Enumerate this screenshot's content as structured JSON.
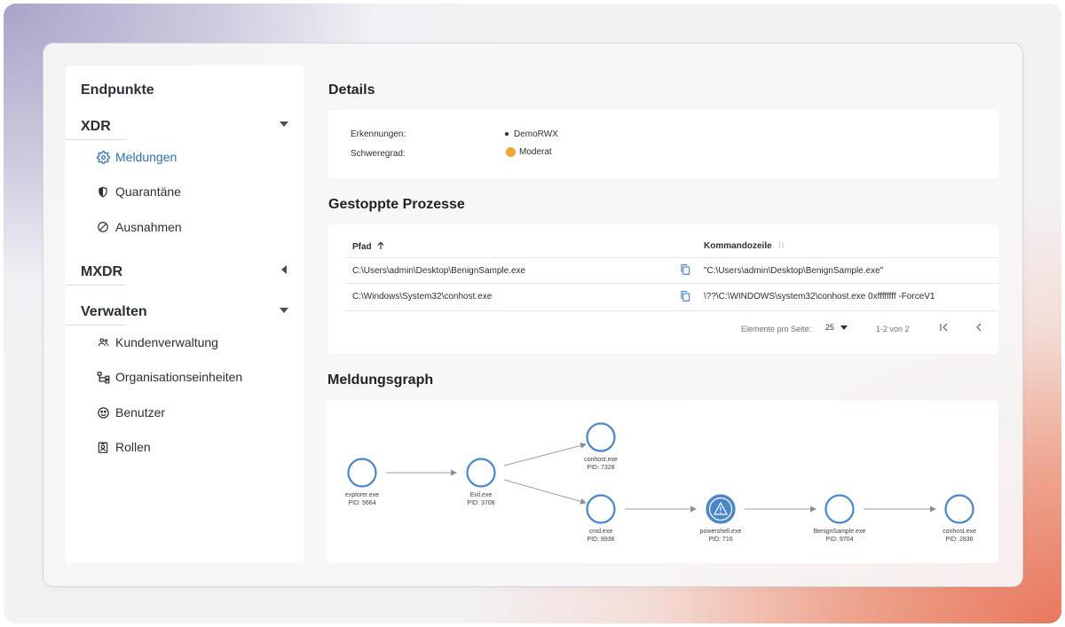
{
  "sidebar": {
    "title": "Endpunkte",
    "sections": [
      {
        "label": "XDR",
        "items": [
          {
            "label": "Meldungen",
            "icon": "gear-icon",
            "active": true
          },
          {
            "label": "Quarantäne",
            "icon": "shield-icon"
          },
          {
            "label": "Ausnahmen",
            "icon": "block-icon"
          }
        ]
      },
      {
        "label": "MXDR",
        "items": []
      },
      {
        "label": "Verwalten",
        "items": [
          {
            "label": "Kundenverwaltung",
            "icon": "users-icon"
          },
          {
            "label": "Organisationseinheiten",
            "icon": "org-units-icon"
          },
          {
            "label": "Benutzer",
            "icon": "user-circle-icon"
          },
          {
            "label": "Rollen",
            "icon": "id-badge-icon"
          }
        ]
      }
    ]
  },
  "details": {
    "heading": "Details",
    "detections_label": "Erkennungen:",
    "detections_value": "DemoRWX",
    "severity_label": "Schweregrad:",
    "severity_value": "Moderat",
    "severity_color": "#f2a636"
  },
  "processes": {
    "heading": "Gestoppte Prozesse",
    "col_path": "Pfad",
    "col_cmd": "Kommandozeile",
    "rows": [
      {
        "path": "C:\\Users\\admin\\Desktop\\BenignSample.exe",
        "cmd": "\"C:\\Users\\admin\\Desktop\\BenignSample.exe\""
      },
      {
        "path": "C:\\Windows\\System32\\conhost.exe",
        "cmd": "\\??\\C:\\WINDOWS\\system32\\conhost.exe 0xffffffff -ForceV1"
      }
    ],
    "pager": {
      "per_page_label": "Elemente pro Seite:",
      "per_page_value": "25",
      "range": "1-2 von 2"
    }
  },
  "graph": {
    "heading": "Meldungsgraph",
    "accent": "#4a86c8",
    "nodes": [
      {
        "name": "explorer.exe",
        "pid": "PID: 5664"
      },
      {
        "name": "Evil.exe",
        "pid": "PID: 3708"
      },
      {
        "name": "conhost.exe",
        "pid": "PID: 7328"
      },
      {
        "name": "cmd.exe",
        "pid": "PID: 8936"
      },
      {
        "name": "powershell.exe",
        "pid": "PID: 716",
        "alert": true
      },
      {
        "name": "BenignSample.exe",
        "pid": "PID: 9704"
      },
      {
        "name": "conhost.exe",
        "pid": "PID: 2836"
      }
    ]
  }
}
